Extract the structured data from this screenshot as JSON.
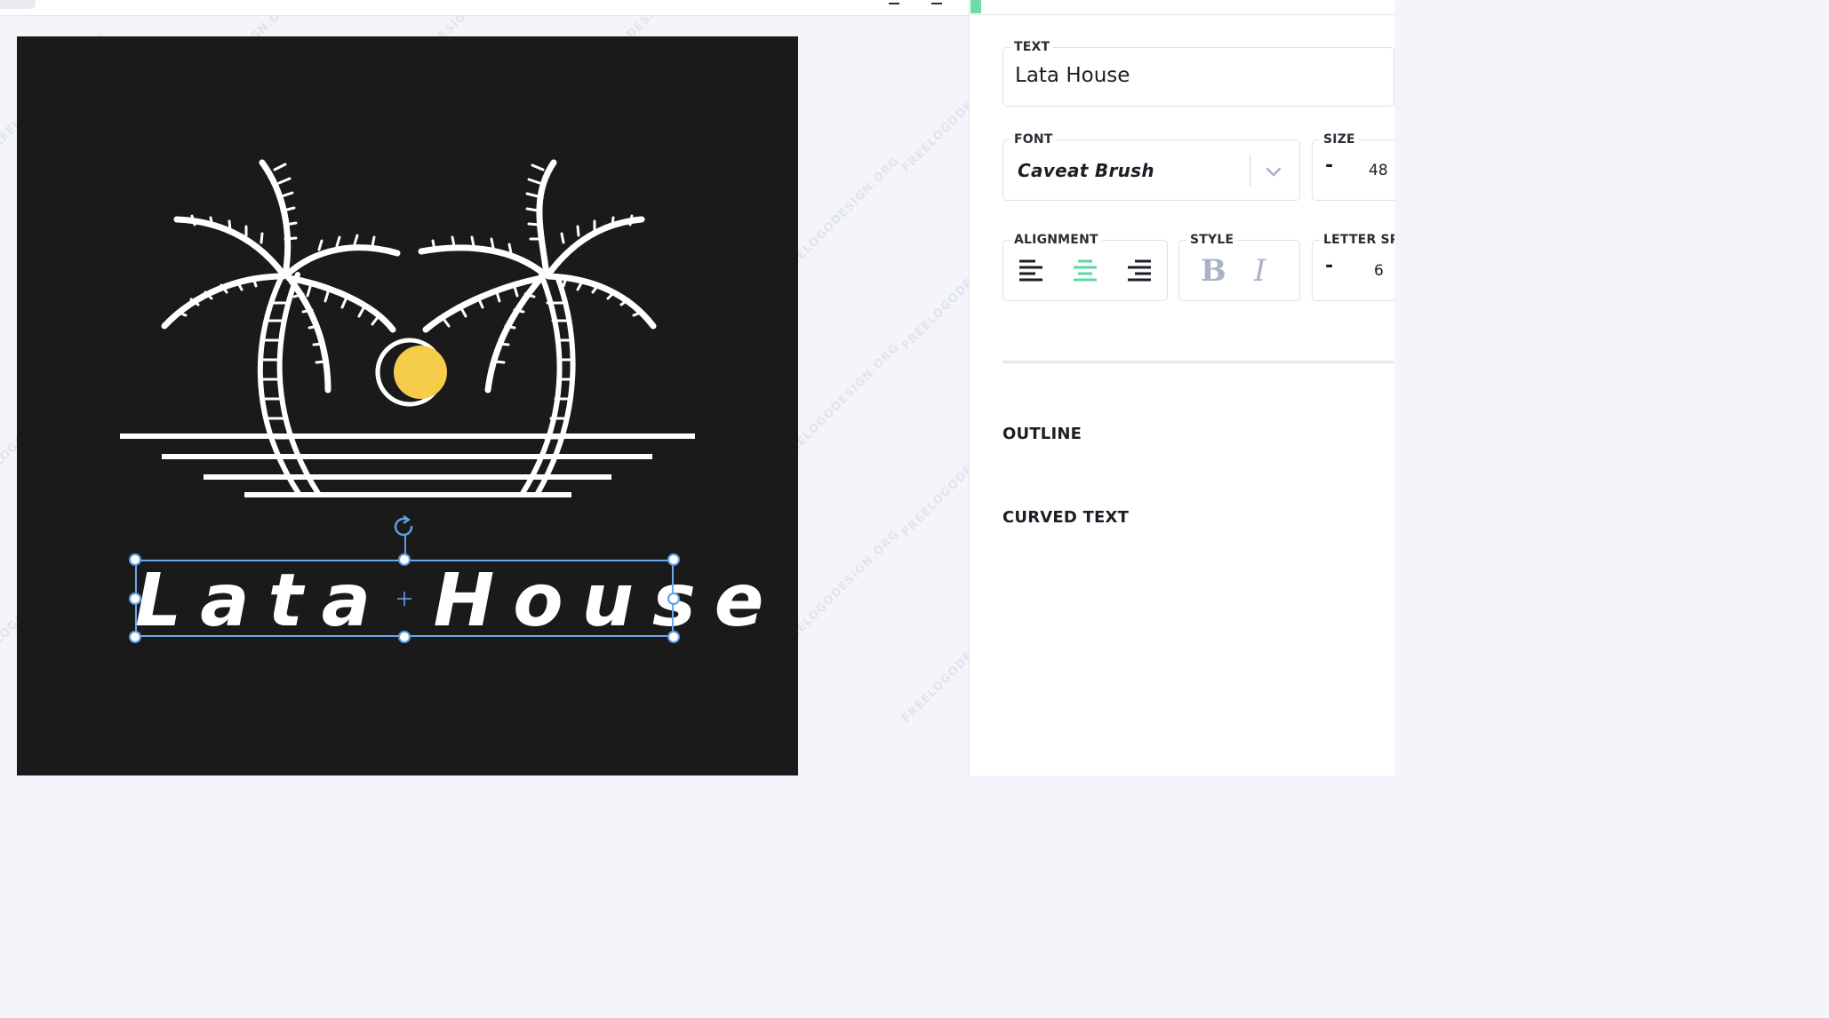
{
  "watermark": {
    "text": "FREELOGODESIGN.ORG"
  },
  "logo": {
    "background_color": "#1a1a1a",
    "art_color": "#ffffff",
    "sun_color": "#f6cd4b",
    "text": "Lata House"
  },
  "selection": {
    "color": "#6aa8ec"
  },
  "panel": {
    "accent_color": "#6fdba8",
    "text_field": {
      "label": "TEXT",
      "value": "Lata House"
    },
    "font_field": {
      "label": "FONT",
      "value": "Caveat Brush"
    },
    "size_field": {
      "label": "SIZE",
      "decrement": "-",
      "value": "48"
    },
    "alignment": {
      "label": "ALIGNMENT",
      "options": [
        "align-left",
        "align-center",
        "align-right"
      ],
      "selected": "align-center",
      "selected_color": "#5fd7a4"
    },
    "style": {
      "label": "STYLE",
      "bold": "B",
      "italic": "I"
    },
    "letter_spacing": {
      "label": "LETTER SP",
      "decrement": "-",
      "value": "6"
    },
    "sections": {
      "outline": "OUTLINE",
      "curved_text": "CURVED TEXT"
    }
  }
}
